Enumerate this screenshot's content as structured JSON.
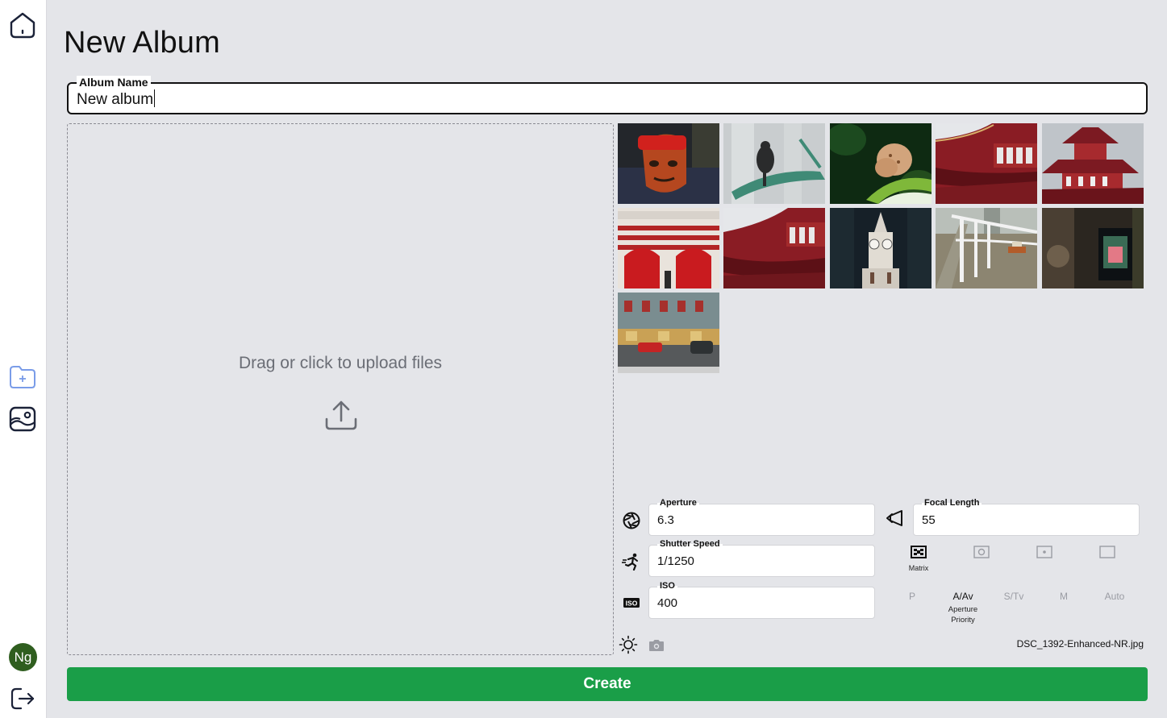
{
  "app": {
    "title": "New Album"
  },
  "sidebar": {
    "home_icon": "home-icon",
    "new_album_icon": "folder-plus-icon",
    "gallery_icon": "image-icon",
    "avatar_initials": "Ng",
    "logout_icon": "logout-icon"
  },
  "album_name": {
    "label": "Album Name",
    "value": "New album"
  },
  "dropzone": {
    "text": "Drag or click to upload files",
    "icon": "upload-icon"
  },
  "photos": [
    {
      "subject": "mask"
    },
    {
      "subject": "bird"
    },
    {
      "subject": "butterfly"
    },
    {
      "subject": "temple-roof"
    },
    {
      "subject": "temple-tower"
    },
    {
      "subject": "red-white-building"
    },
    {
      "subject": "temple-roof-2"
    },
    {
      "subject": "clock-tower"
    },
    {
      "subject": "riverside-railing"
    },
    {
      "subject": "dark-window"
    },
    {
      "subject": "shophouse-street"
    }
  ],
  "exif": {
    "aperture": {
      "label": "Aperture",
      "value": "6.3",
      "icon": "aperture-icon"
    },
    "focal_length": {
      "label": "Focal Length",
      "value": "55",
      "icon": "lens-icon"
    },
    "shutter_speed": {
      "label": "Shutter Speed",
      "value": "1/1250",
      "icon": "running-icon"
    },
    "iso": {
      "label": "ISO",
      "value": "400",
      "icon": "iso-icon"
    },
    "metering": [
      {
        "name": "matrix",
        "label": "Matrix",
        "active": true,
        "icon": "matrix-metering-icon"
      },
      {
        "name": "center",
        "label": "",
        "active": false,
        "icon": "center-weighted-icon"
      },
      {
        "name": "spot",
        "label": "",
        "active": false,
        "icon": "spot-metering-icon"
      },
      {
        "name": "highlight",
        "label": "",
        "active": false,
        "icon": "highlight-metering-icon"
      }
    ],
    "modes": [
      {
        "label": "P",
        "sub": "",
        "active": false
      },
      {
        "label": "A/Av",
        "sub": "Aperture Priority",
        "active": true
      },
      {
        "label": "S/Tv",
        "sub": "",
        "active": false
      },
      {
        "label": "M",
        "sub": "",
        "active": false
      },
      {
        "label": "Auto",
        "sub": "",
        "active": false
      }
    ],
    "white_balance_icon": "sun-icon",
    "flash_icon": "camera-icon",
    "filename": "DSC_1392-Enhanced-NR.jpg"
  },
  "actions": {
    "create_label": "Create"
  },
  "colors": {
    "accent": "#1a9e48",
    "background": "#e4e5e9",
    "avatar": "#2f5e1f"
  }
}
